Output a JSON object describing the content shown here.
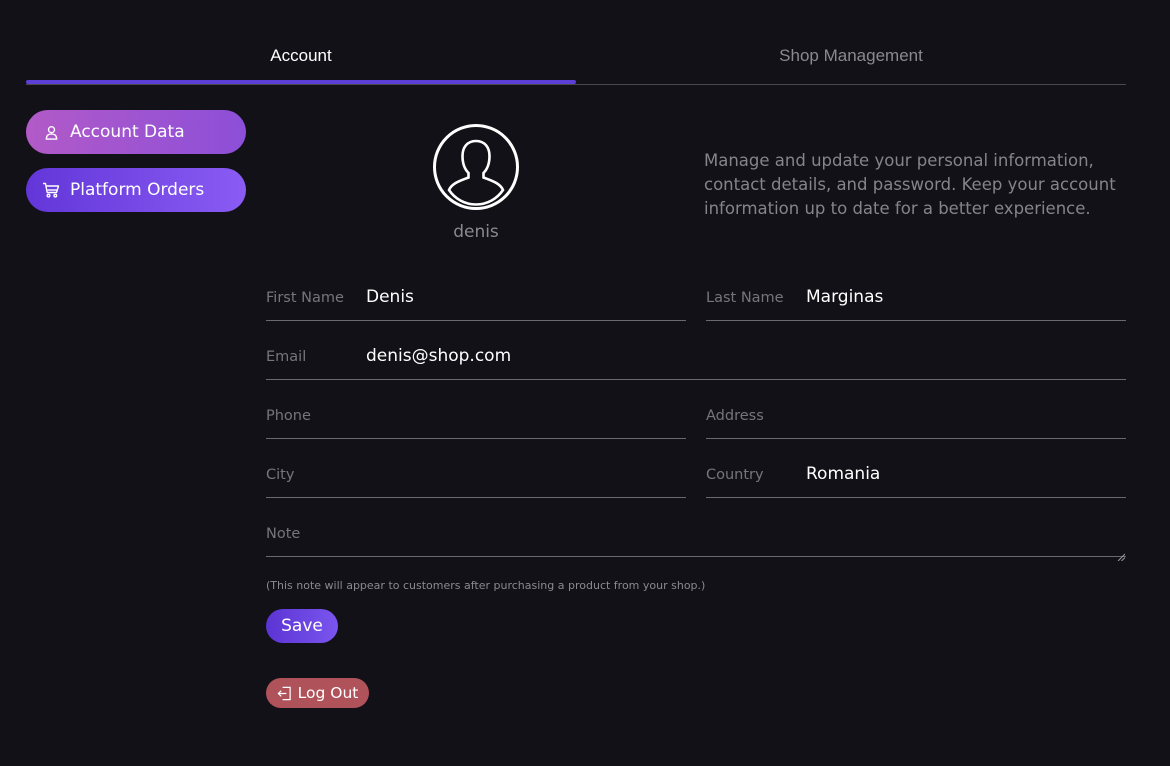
{
  "tabs": [
    {
      "label": "Account",
      "active": true
    },
    {
      "label": "Shop Management",
      "active": false
    }
  ],
  "sidebar": {
    "items": [
      {
        "label": "Account Data",
        "icon": "user-icon"
      },
      {
        "label": "Platform Orders",
        "icon": "cart-icon"
      }
    ]
  },
  "profile": {
    "avatar_icon": "user-avatar-icon",
    "username": "denis",
    "description": "Manage and update your personal information, contact details, and password. Keep your account information up to date for a better experience."
  },
  "form": {
    "first_name": {
      "label": "First Name",
      "value": "Denis"
    },
    "last_name": {
      "label": "Last Name",
      "value": "Marginas"
    },
    "email": {
      "label": "Email",
      "value": "denis@shop.com"
    },
    "phone": {
      "label": "Phone",
      "value": ""
    },
    "address": {
      "label": "Address",
      "value": ""
    },
    "city": {
      "label": "City",
      "value": ""
    },
    "country": {
      "label": "Country",
      "value": "Romania"
    },
    "note": {
      "label": "Note",
      "value": ""
    },
    "note_hint": "(This note will appear to customers after purchasing a product from your shop.)"
  },
  "actions": {
    "save_label": "Save",
    "logout_label": "Log Out"
  },
  "colors": {
    "background": "#121117",
    "accent": "#5b3fd6",
    "logout": "#b0525a"
  }
}
